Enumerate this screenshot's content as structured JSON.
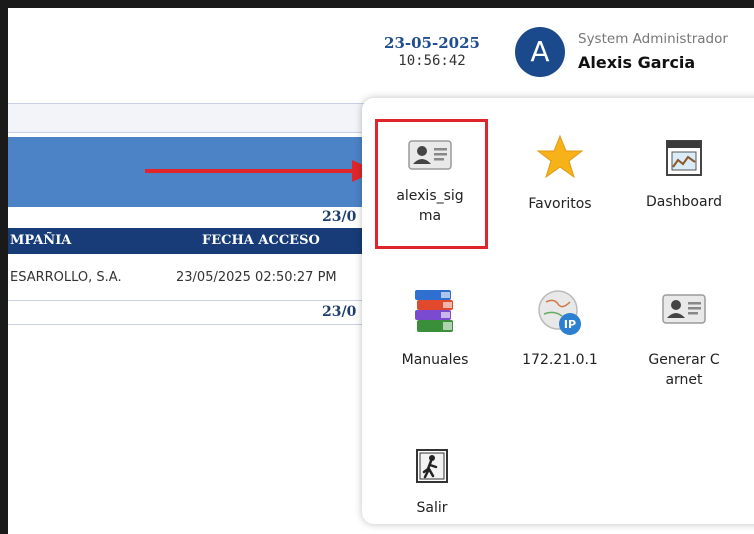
{
  "header": {
    "date": "23-05-2025",
    "time": "10:56:42",
    "avatar_letter": "A",
    "role": "System Administrador",
    "user_name": "Alexis Garcia"
  },
  "table": {
    "date_top": "23/0",
    "columns": [
      "MPAÑIA",
      "FECHA ACCESO"
    ],
    "rows": [
      {
        "company": "ESARROLLO, S.A.",
        "access": "23/05/2025 02:50:27 PM"
      }
    ],
    "date_bottom": "23/0"
  },
  "menu": {
    "items": [
      {
        "label": "alexis_sig\nma",
        "icon": "id-card-icon"
      },
      {
        "label": "Favoritos",
        "icon": "star-icon"
      },
      {
        "label": "Dashboard",
        "icon": "dashboard-icon"
      },
      {
        "label": "Manuales",
        "icon": "books-icon"
      },
      {
        "label": "172.21.0.1",
        "icon": "ip-globe-icon"
      },
      {
        "label": "Generar C\narnet",
        "icon": "id-card-icon"
      },
      {
        "label": "Salir",
        "icon": "exit-door-icon"
      }
    ]
  },
  "colors": {
    "accent": "#1f4d8f",
    "highlight": "#e0262a",
    "table_header": "#173c77",
    "table_band": "#4c83c6"
  }
}
